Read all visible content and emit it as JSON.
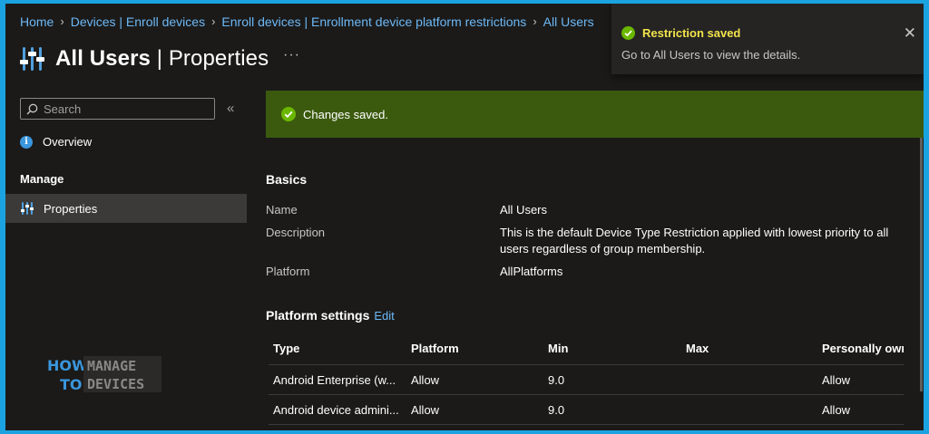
{
  "breadcrumb": [
    {
      "label": "Home"
    },
    {
      "label": "Devices | Enroll devices"
    },
    {
      "label": "Enroll devices | Enrollment device platform restrictions"
    },
    {
      "label": "All Users"
    }
  ],
  "header": {
    "title_bold": "All Users",
    "title_separator": " | ",
    "title_light": "Properties",
    "more_label": "···",
    "icon": "device-restrictions-icon"
  },
  "sidebar": {
    "search_placeholder": "Search",
    "collapse_label": "«",
    "overview_label": "Overview",
    "manage_heading": "Manage",
    "properties_label": "Properties"
  },
  "toast": {
    "title": "Restriction saved",
    "message": "Go to All Users to view the details.",
    "close_label": "✕"
  },
  "banner": {
    "message": "Changes saved."
  },
  "basics": {
    "heading": "Basics",
    "name_label": "Name",
    "name_value": "All Users",
    "description_label": "Description",
    "description_value": "This is the default Device Type Restriction applied with lowest priority to all users regardless of group membership.",
    "platform_label": "Platform",
    "platform_value": "AllPlatforms"
  },
  "platform_settings": {
    "heading": "Platform settings",
    "edit_label": "Edit",
    "columns": [
      "Type",
      "Platform",
      "Min",
      "Max",
      "Personally own"
    ],
    "rows": [
      [
        "Android Enterprise (w...",
        "Allow",
        "9.0",
        "",
        "Allow"
      ],
      [
        "Android device admini...",
        "Allow",
        "9.0",
        "",
        "Allow"
      ]
    ]
  },
  "watermark": {
    "word1": "HOW",
    "word2": "TO",
    "word3": "MANAGE",
    "word4": "DEVICES"
  },
  "colors": {
    "background": "#1b1a19",
    "link": "#6cb8f6",
    "banner": "#3b5a0e",
    "success": "#6bb700",
    "toast_title": "#f2e34b",
    "frame_border": "#1aa3e0"
  }
}
